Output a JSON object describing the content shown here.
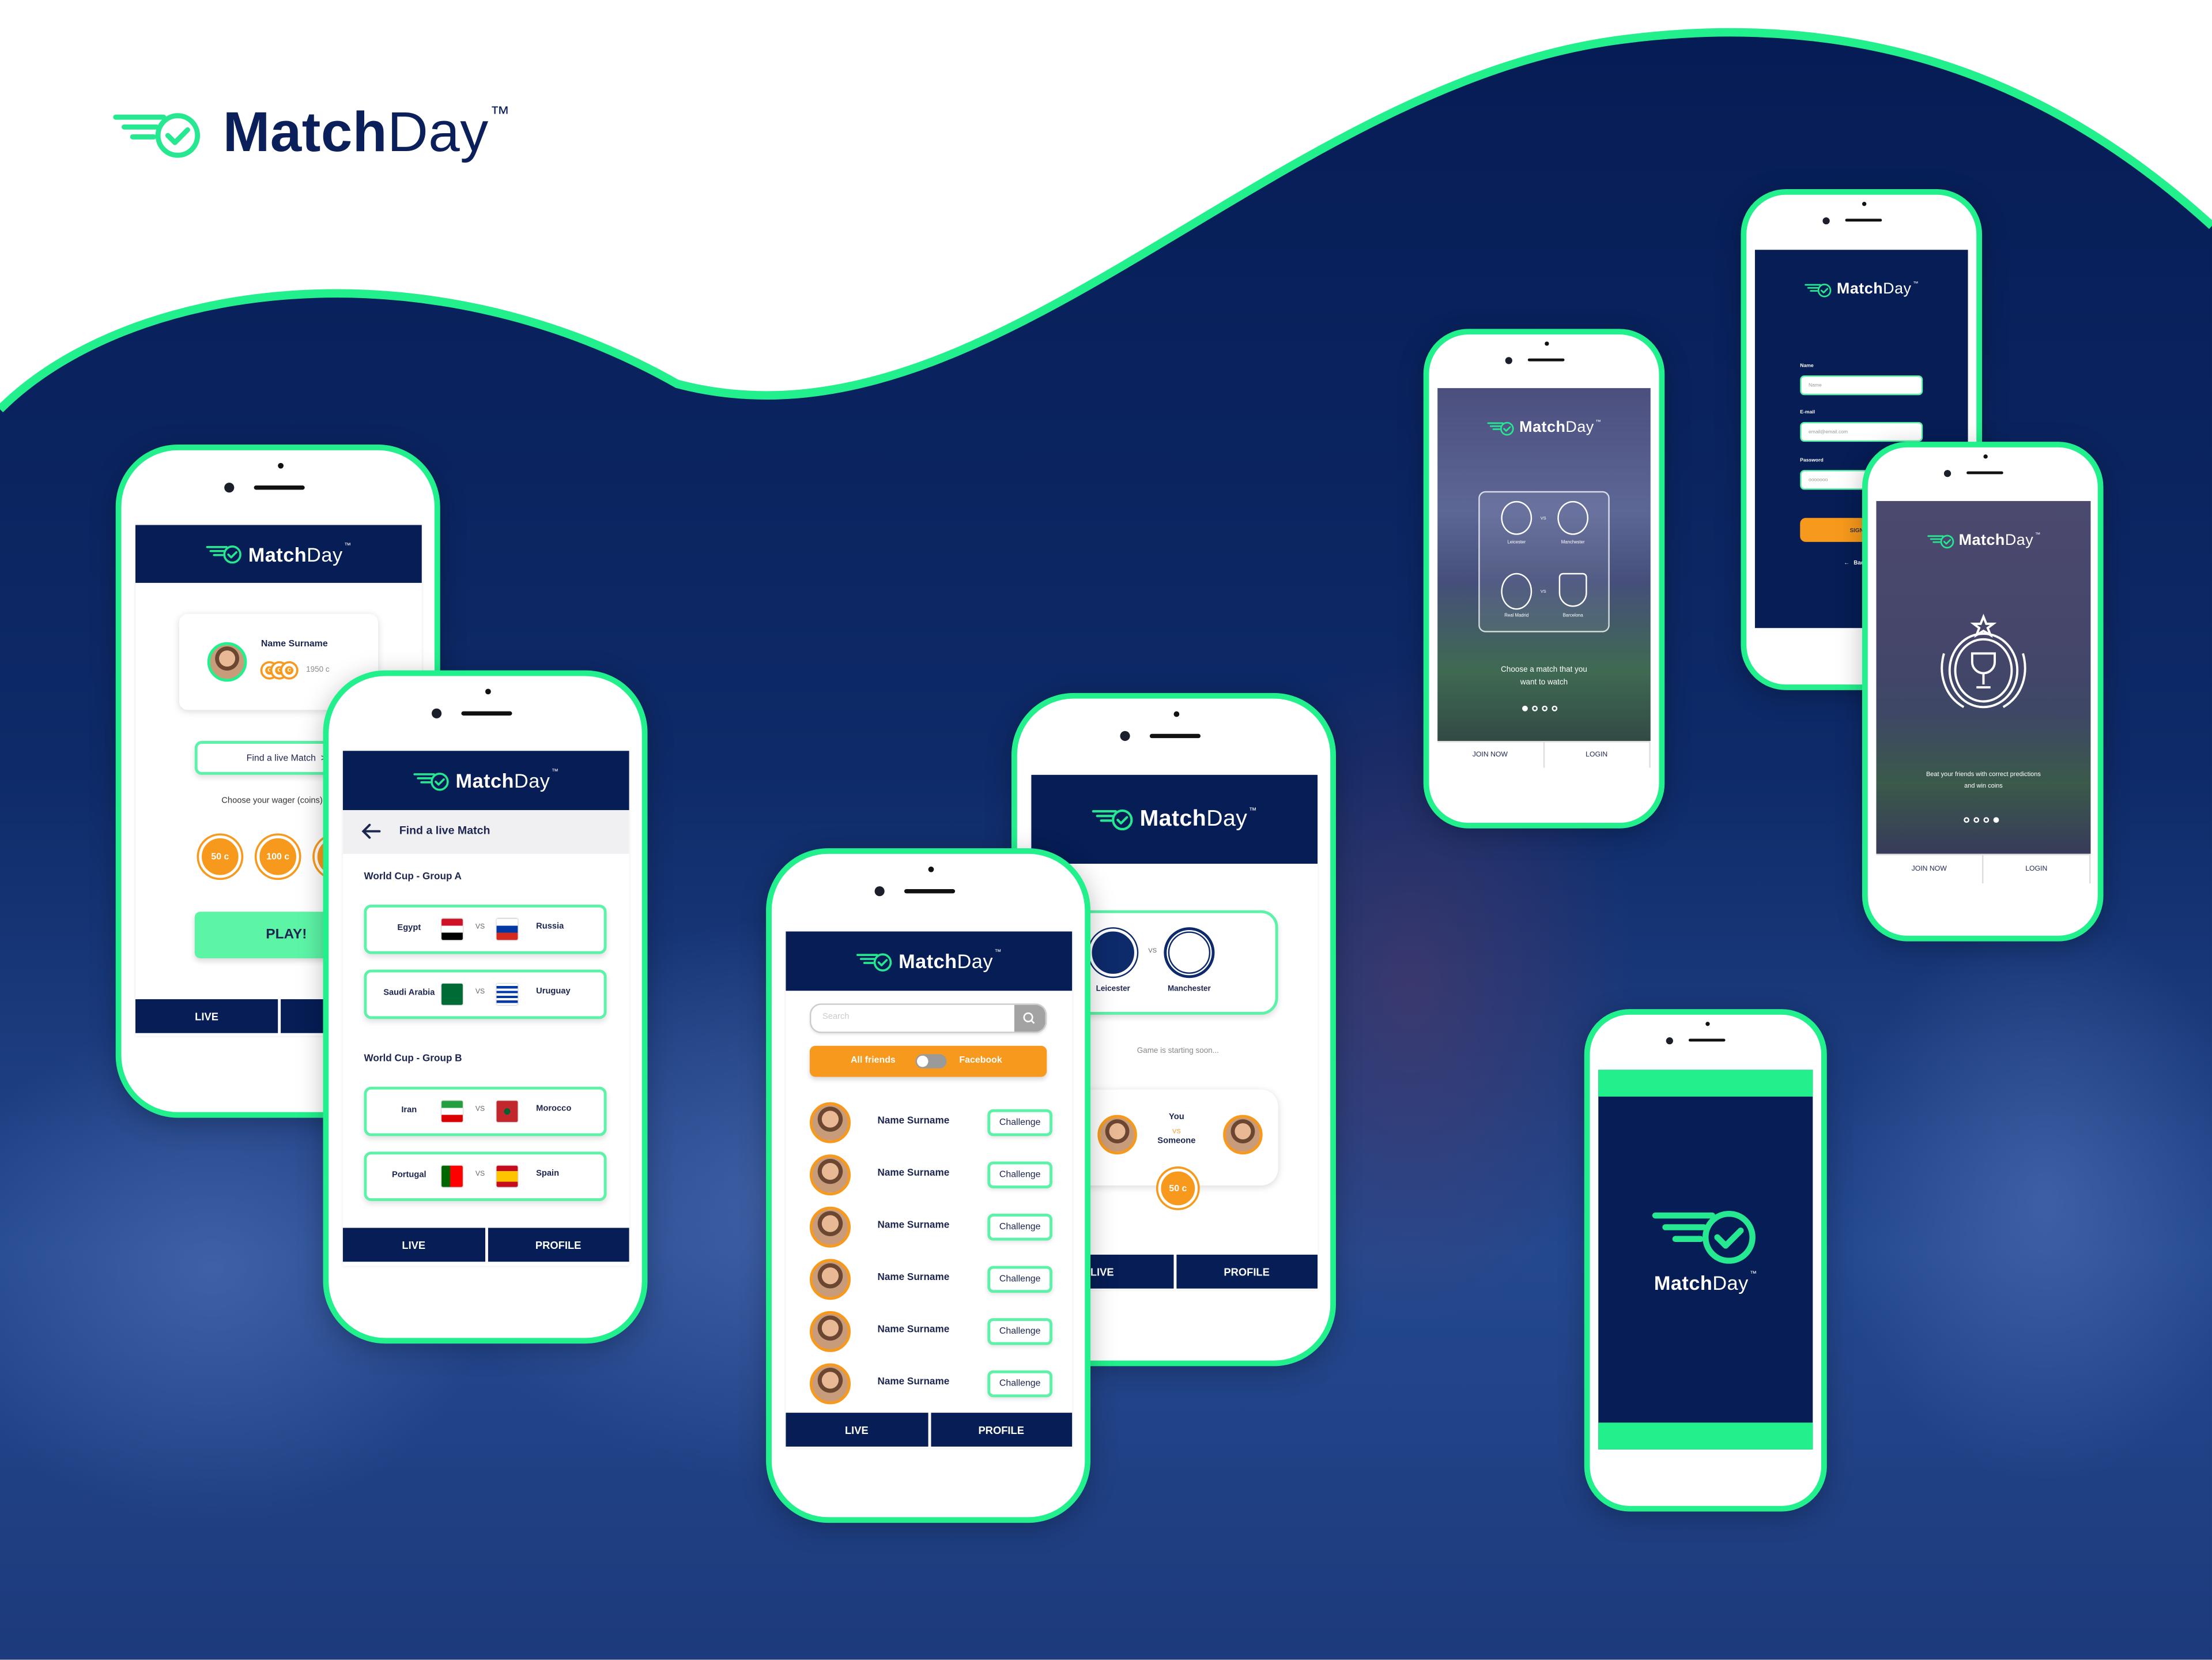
{
  "brand": {
    "match": "Match",
    "day": "Day",
    "tm": "™"
  },
  "colors": {
    "navy": "#061d55",
    "green": "#22f08c",
    "mint": "#5cf5a6",
    "orange": "#f7991c"
  },
  "profile_screen": {
    "user_name": "Name Surname",
    "coin_glyph": "c",
    "coin_balance": "1950 c",
    "find_button": "Find a live Match  >",
    "wager_label": "Choose your wager (coins)",
    "wagers": [
      "50 c",
      "100 c",
      ""
    ],
    "play_button": "PLAY!",
    "nav": [
      "LIVE",
      "PROFILE"
    ]
  },
  "find_match_screen": {
    "title": "Find a live Match",
    "back_icon": "arrow-left-icon",
    "vs": "VS",
    "groups": [
      {
        "name": "World Cup - Group A",
        "matches": [
          {
            "home": "Egypt",
            "home_flag": "egypt",
            "away": "Russia",
            "away_flag": "russia"
          },
          {
            "home": "Saudi Arabia",
            "home_flag": "saudi",
            "away": "Uruguay",
            "away_flag": "uruguay"
          }
        ]
      },
      {
        "name": "World Cup - Group B",
        "matches": [
          {
            "home": "Iran",
            "home_flag": "iran",
            "away": "Morocco",
            "away_flag": "morocco"
          },
          {
            "home": "Portugal",
            "home_flag": "portugal",
            "away": "Spain",
            "away_flag": "spain"
          }
        ]
      }
    ],
    "nav": [
      "LIVE",
      "PROFILE"
    ]
  },
  "friends_screen": {
    "search_placeholder": "Search",
    "search_icon": "search-icon",
    "toggle_left": "All friends",
    "toggle_right": "Facebook",
    "challenge_label": "Challenge",
    "friends": [
      "Name Surname",
      "Name Surname",
      "Name Surname",
      "Name Surname",
      "Name Surname",
      "Name Surname"
    ],
    "nav": [
      "LIVE",
      "PROFILE"
    ]
  },
  "match_screen": {
    "home": "Leicester",
    "away": "Manchester",
    "vs": "VS",
    "status": "Game is starting soon...",
    "you": "You",
    "vs_small": "VS",
    "opponent": "Someone",
    "wager": "50 c",
    "nav": [
      "LIVE",
      "PROFILE"
    ]
  },
  "onboarding_1": {
    "clubs": [
      {
        "home": "Leicester",
        "away": "Manchester"
      },
      {
        "home": "Real Madrid",
        "away": "Barcelona"
      }
    ],
    "vs": "VS",
    "caption_1": "Choose a match that you",
    "caption_2": "want to watch",
    "page": 1,
    "pages": 4,
    "join": "JOIN NOW",
    "login": "LOGIN"
  },
  "signup_screen": {
    "name_label": "Name",
    "name_placeholder": "Name",
    "email_label": "E-mail",
    "email_placeholder": "email@email.com",
    "password_label": "Password",
    "password_placeholder": "ooooooo",
    "signup_button": "SIGN UP",
    "back": "Back"
  },
  "onboarding_2": {
    "caption_1": "Beat your friends with correct predictions",
    "caption_2": "and win coins",
    "page": 4,
    "pages": 4,
    "join": "JOIN NOW",
    "login": "LOGIN"
  }
}
